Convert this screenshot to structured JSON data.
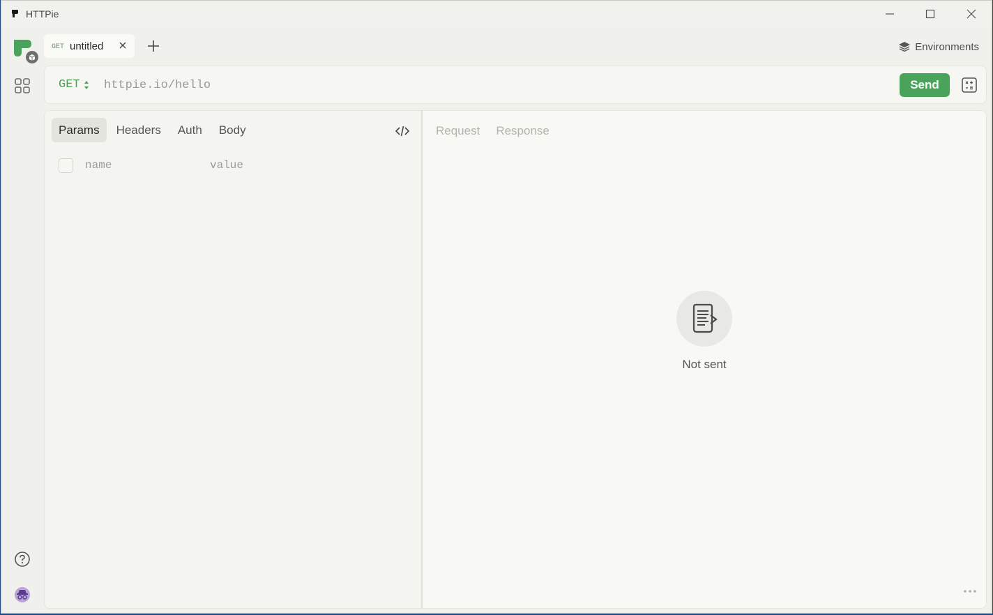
{
  "window": {
    "title": "HTTPie"
  },
  "tabs": [
    {
      "method": "GET",
      "name": "untitled"
    }
  ],
  "header": {
    "environments_label": "Environments"
  },
  "request": {
    "method": "GET",
    "url_placeholder": "httpie.io/hello",
    "send_label": "Send",
    "tabs": [
      "Params",
      "Headers",
      "Auth",
      "Body"
    ],
    "active_tab": "Params",
    "params": {
      "name_placeholder": "name",
      "value_placeholder": "value"
    }
  },
  "response": {
    "tabs": [
      "Request",
      "Response"
    ],
    "empty_state": "Not sent"
  },
  "colors": {
    "send": "#4aa35a",
    "method": "#4d9e55"
  }
}
